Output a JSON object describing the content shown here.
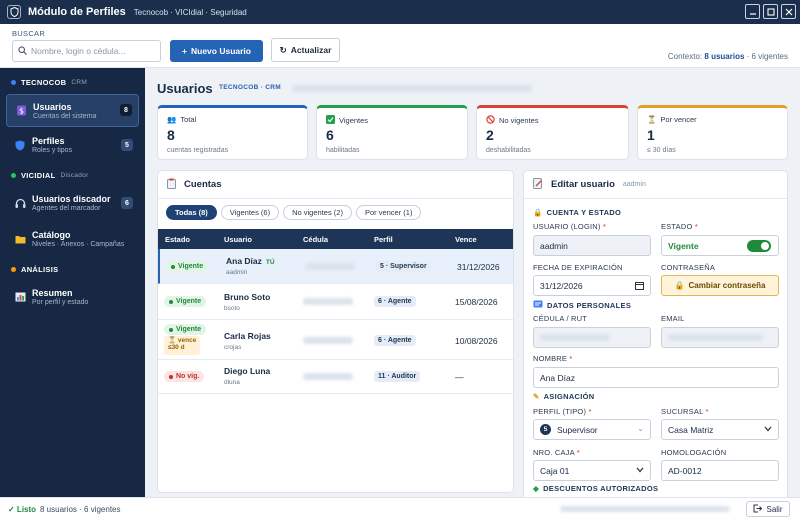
{
  "window": {
    "title": "Módulo de Perfiles",
    "subtitle": "Tecnocob · VICIdial · Seguridad",
    "icons": [
      "shield-icon",
      "minimize-icon",
      "maximize-icon",
      "close-icon"
    ]
  },
  "toolbar": {
    "search_label": "BUSCAR",
    "search_placeholder": "Nombre, login o cédula...",
    "new_user": "Nuevo Usuario",
    "refresh": "Actualizar",
    "context_prefix": "Contexto:",
    "context_users": "8 usuarios",
    "context_rest": "· 6 vigentes"
  },
  "sidebar": {
    "sections": [
      {
        "label": "TECNOCOB",
        "tag": "CRM",
        "color": "#3b82f6"
      },
      {
        "label": "VICIDIAL",
        "tag": "Discador",
        "color": "#22c55e"
      },
      {
        "label": "ANÁLISIS",
        "tag": "",
        "color": "#f59e0b"
      }
    ],
    "items": [
      {
        "label": "Usuarios",
        "sub": "Cuentas del sistema",
        "count": "8",
        "icon": "user-dollar-icon"
      },
      {
        "label": "Perfiles",
        "sub": "Roles y tipos",
        "count": "5",
        "icon": "shield-icon"
      },
      {
        "label": "Usuarios discador",
        "sub": "Agentes del marcador",
        "count": "6",
        "icon": "headset-icon"
      },
      {
        "label": "Catálogo",
        "sub": "Niveles · Anexos · Campañas",
        "count": "",
        "icon": "folder-icon"
      },
      {
        "label": "Resumen",
        "sub": "Por perfil y estado",
        "count": "",
        "icon": "bar-chart-icon"
      }
    ]
  },
  "main": {
    "title": "Usuarios",
    "crumb": "TECNOCOB · CRM"
  },
  "cards": [
    {
      "title": "Total",
      "value": "8",
      "sub": "cuentas registradas",
      "color": "#2563b5",
      "icon": "users-icon"
    },
    {
      "title": "Vigentes",
      "value": "6",
      "sub": "habilitadas",
      "color": "#22a04b",
      "icon": "check-icon"
    },
    {
      "title": "No vigentes",
      "value": "2",
      "sub": "deshabilitadas",
      "color": "#d9423a",
      "icon": "ban-icon"
    },
    {
      "title": "Por vencer",
      "value": "1",
      "sub": "≤ 30 días",
      "color": "#e0a020",
      "icon": "hourglass-icon"
    }
  ],
  "accounts": {
    "title": "Cuentas",
    "filters": [
      "Todas (8)",
      "Vigentes (6)",
      "No vigentes (2)",
      "Por vencer (1)"
    ],
    "columns": [
      "Estado",
      "Usuario",
      "Cédula",
      "Perfil",
      "Vence"
    ],
    "rows": [
      {
        "status": "Vigente",
        "name": "Ana Díaz",
        "you": "TÚ",
        "login": "aadmin",
        "profile": "5 · Supervisor",
        "expires": "31/12/2026"
      },
      {
        "status": "Vigente",
        "name": "Bruno Soto",
        "login": "bsoto",
        "profile": "6 · Agente",
        "expires": "15/08/2026"
      },
      {
        "status": "Vigente",
        "warn1": "vence",
        "warn2": "≤30 d",
        "name": "Carla Rojas",
        "login": "crojas",
        "profile": "6 · Agente",
        "expires": "10/08/2026"
      },
      {
        "status": "No vig.",
        "name": "Diego Luna",
        "login": "dluna",
        "profile": "11 · Auditor",
        "expires": "—"
      }
    ]
  },
  "edit": {
    "title": "Editar usuario",
    "login_tag": "aadmin",
    "sec_account": "CUENTA Y ESTADO",
    "login_label": "USUARIO (LOGIN)",
    "login_value": "aadmin",
    "state_label": "ESTADO",
    "state_value": "Vigente",
    "expiry_label": "FECHA DE EXPIRACIÓN",
    "expiry_value": "31/12/2026",
    "password_label": "CONTRASEÑA",
    "password_button": "Cambiar contraseña",
    "sec_personal": "DATOS PERSONALES",
    "id_label": "CÉDULA / RUT",
    "email_label": "EMAIL",
    "name_label": "NOMBRE",
    "name_value": "Ana Díaz",
    "sec_assign": "ASIGNACIÓN",
    "profile_label": "PERFIL (TIPO)",
    "profile_badge": "5",
    "profile_value": "Supervisor",
    "branch_label": "SUCURSAL",
    "branch_value": "Casa Matriz",
    "box_label": "NRO. CAJA",
    "box_value": "Caja 01",
    "homolog_label": "HOMOLOGACIÓN",
    "homolog_value": "AD-0012",
    "sec_discounts": "DESCUENTOS AUTORIZADOS",
    "req": "*"
  },
  "status": {
    "ready": "✓ Listo",
    "text": "8 usuarios · 6 vigentes",
    "exit": "Salir"
  }
}
